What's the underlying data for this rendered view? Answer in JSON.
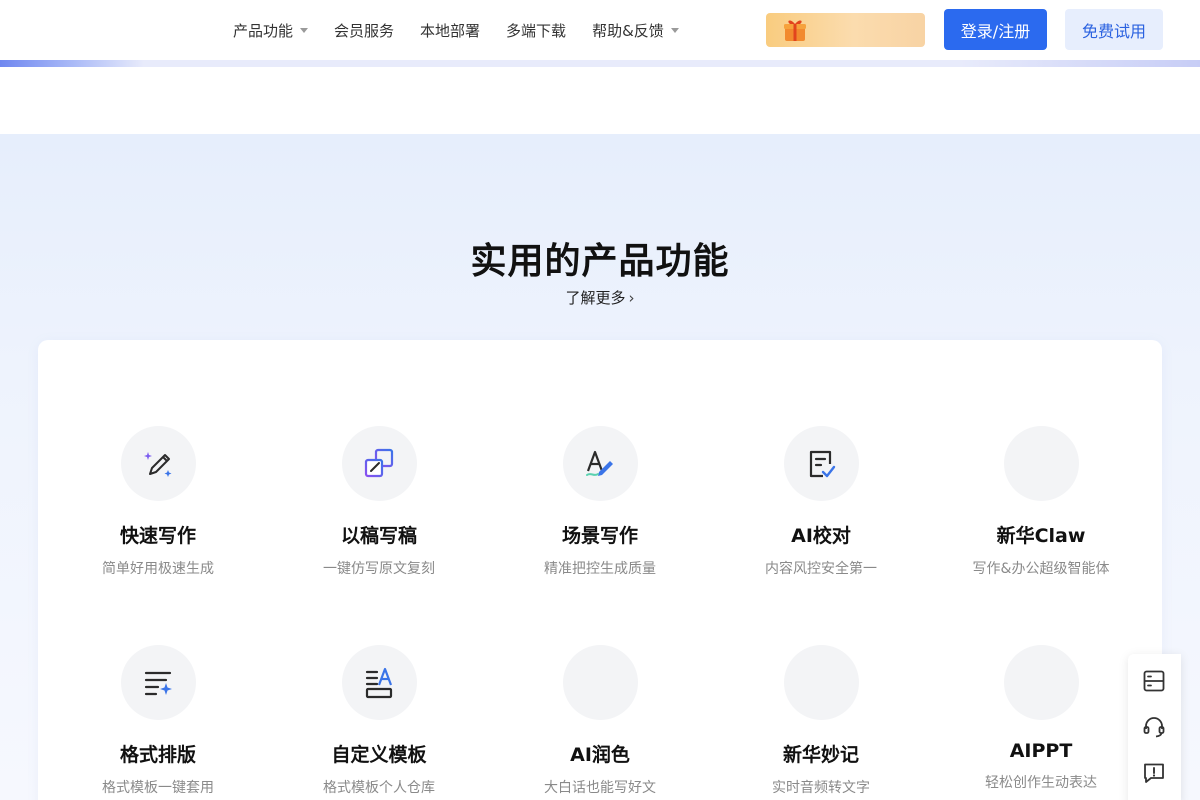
{
  "nav": {
    "items": [
      {
        "label": "产品功能",
        "has_dropdown": true
      },
      {
        "label": "会员服务",
        "has_dropdown": false
      },
      {
        "label": "本地部署",
        "has_dropdown": false
      },
      {
        "label": "多端下载",
        "has_dropdown": false
      },
      {
        "label": "帮助&反馈",
        "has_dropdown": true
      }
    ],
    "promo_icon": "gift-icon",
    "login_label": "登录/注册",
    "trial_label": "免费试用"
  },
  "colors": {
    "primary": "#2b6aef",
    "trial_bg": "#e7eefd",
    "promo": "#f9cc7f",
    "icon_purple": "#7b5cf0",
    "icon_blue": "#3a74e8"
  },
  "section": {
    "title": "实用的产品功能",
    "learn_more": "了解更多",
    "features": [
      {
        "name": "快速写作",
        "desc": "简单好用极速生成",
        "icon": "magic-pen-icon"
      },
      {
        "name": "以稿写稿",
        "desc": "一键仿写原文复刻",
        "icon": "copy-edit-icon"
      },
      {
        "name": "场景写作",
        "desc": "精准把控生成质量",
        "icon": "text-style-icon"
      },
      {
        "name": "AI校对",
        "desc": "内容风控安全第一",
        "icon": "document-check-icon"
      },
      {
        "name": "新华Claw",
        "desc": "写作&办公超级智能体",
        "icon": ""
      },
      {
        "name": "格式排版",
        "desc": "格式模板一键套用",
        "icon": "format-sparkle-icon"
      },
      {
        "name": "自定义模板",
        "desc": "格式模板个人仓库",
        "icon": "template-icon"
      },
      {
        "name": "AI润色",
        "desc": "大白话也能写好文",
        "icon": ""
      },
      {
        "name": "新华妙记",
        "desc": "实时音频转文字",
        "icon": ""
      },
      {
        "name": "AIPPT",
        "desc": "轻松创作生动表达",
        "icon": ""
      }
    ]
  },
  "side_tools": [
    "server-icon",
    "headset-icon",
    "feedback-icon"
  ]
}
